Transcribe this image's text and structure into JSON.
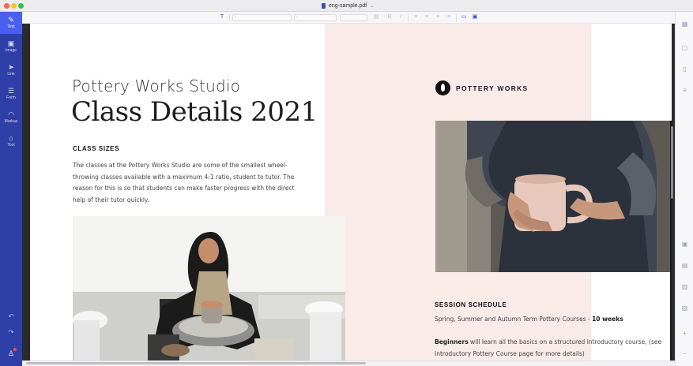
{
  "window": {
    "file_name": "eng-sample.pdf"
  },
  "toolbar": {
    "font_family_value": "-",
    "font_size_value": "-",
    "line_height_value": "-",
    "icons": [
      "text-edit-icon",
      "color-swatch-icon",
      "bold-icon",
      "italic-icon",
      "align-left-icon",
      "align-center-icon",
      "align-right-icon",
      "align-justify-icon",
      "text-box-icon",
      "text-box-selected-icon"
    ]
  },
  "sidebar": {
    "items": [
      {
        "label": "Text",
        "icon": "pen-icon",
        "active": true
      },
      {
        "label": "Image",
        "icon": "image-icon",
        "active": false
      },
      {
        "label": "Link",
        "icon": "link-icon",
        "active": false
      },
      {
        "label": "Form",
        "icon": "form-icon",
        "active": false
      },
      {
        "label": "Markup",
        "icon": "markup-icon",
        "active": false
      },
      {
        "label": "Tool",
        "icon": "tool-icon",
        "active": false
      }
    ],
    "bottom_icons": [
      "undo-icon",
      "redo-icon",
      "account-icon"
    ]
  },
  "rightbar": {
    "icons": [
      "thumbnails-icon",
      "page-icon",
      "bookmark-icon",
      "outline-icon",
      "properties-icon",
      "convert-icon",
      "protect-icon",
      "sign-icon",
      "zoom-in-icon",
      "zoom-out-icon"
    ]
  },
  "document": {
    "subtitle": "Pottery Works Studio",
    "title": "Class Details 2021",
    "class_sizes_heading": "CLASS SIZES",
    "class_sizes_text": "The classes at the Pottery Works Studio are some of the smallest wheel-throwing classes available with a maximum 4:1 ratio, student to tutor. The reason for this is so that students can make faster progress with the direct help of their tutor quickly.",
    "brand_name": "POTTERY WORKS",
    "session_heading": "SESSION SCHEDULE",
    "session_line_prefix": "Spring, Summer and Autumn Term Pottery Courses - ",
    "session_line_bold": "10 weeks",
    "beginners_bold": "Beginners",
    "beginners_text": " will learn all the basics on a structured Introductory course, (see Introductory Pottery Course page for more details)",
    "photo_left_desc": "woman-at-pottery-wheel-photo",
    "photo_right_desc": "hands-holding-mug-photo"
  },
  "colors": {
    "sidebar_bg": "#2f3fa8",
    "sidebar_active": "#4a5ff0",
    "accent_pink": "#f9ebe8"
  }
}
